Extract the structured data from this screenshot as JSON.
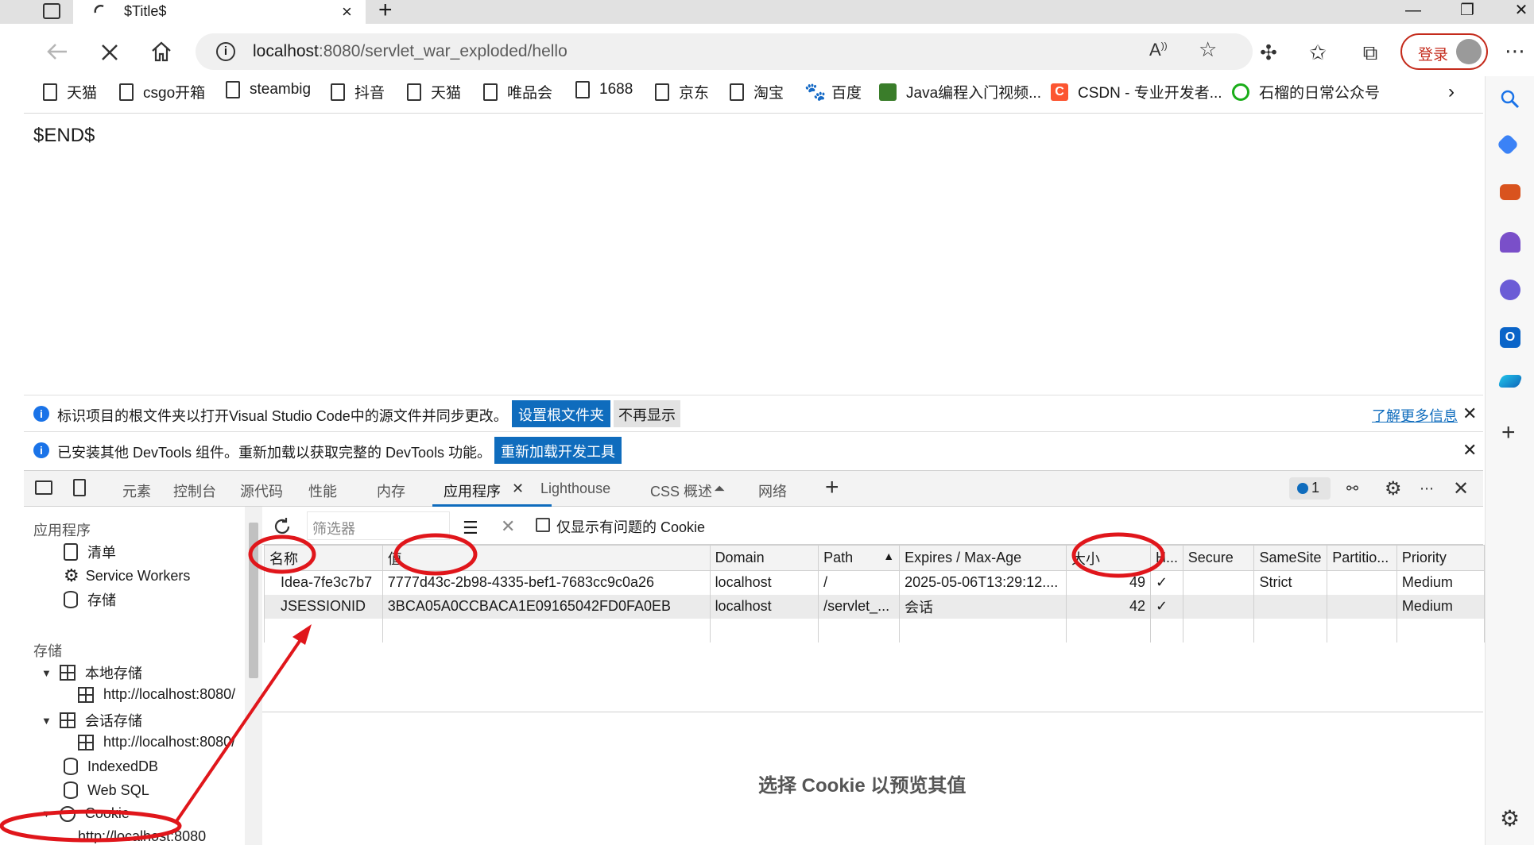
{
  "browser": {
    "tab_title": "$Title$",
    "tab_close": "×",
    "new_tab": "+",
    "window_controls": [
      "—",
      "❐",
      "✕"
    ],
    "url_host": "localhost",
    "url_path": ":8080/servlet_war_exploded/hello",
    "login_label": "登录",
    "menu_icon": "⋯"
  },
  "bookmarks": [
    {
      "label": "天猫",
      "icon": "page-icon"
    },
    {
      "label": "csgo开箱",
      "icon": "page-icon"
    },
    {
      "label": "steambig",
      "icon": "page-icon"
    },
    {
      "label": "抖音",
      "icon": "page-icon"
    },
    {
      "label": "天猫",
      "icon": "page-icon"
    },
    {
      "label": "唯品会",
      "icon": "page-icon"
    },
    {
      "label": "1688",
      "icon": "page-icon"
    },
    {
      "label": "京东",
      "icon": "page-icon"
    },
    {
      "label": "淘宝",
      "icon": "page-icon"
    },
    {
      "label": "百度",
      "icon": "baidu-icon"
    },
    {
      "label": "Java编程入门视频...",
      "icon": "java-video-icon"
    },
    {
      "label": "CSDN - 专业开发者...",
      "icon": "csdn-icon"
    },
    {
      "label": "石榴的日常公众号",
      "icon": "wechat-icon"
    }
  ],
  "page": {
    "body_text": "$END$"
  },
  "infobars": {
    "first_text": "标识项目的根文件夹以打开Visual Studio Code中的源文件并同步更改。",
    "first_primary": "设置根文件夹",
    "first_secondary": "不再显示",
    "first_link": "了解更多信息",
    "second_text": "已安装其他 DevTools 组件。重新加载以获取完整的 DevTools 功能。",
    "second_primary": "重新加载开发工具"
  },
  "devtools": {
    "tabs": [
      "元素",
      "控制台",
      "源代码",
      "性能",
      "内存",
      "应用程序",
      "Lighthouse",
      "CSS 概述",
      "网络"
    ],
    "active_tab": "应用程序",
    "issues_count": "1",
    "left": {
      "section_app": "应用程序",
      "app_items": [
        "清单",
        "Service Workers",
        "存储"
      ],
      "section_storage": "存储",
      "local_storage": "本地存储",
      "local_storage_origin": "http://localhost:8080/",
      "session_storage": "会话存储",
      "session_storage_origin": "http://localhost:8080/",
      "indexeddb": "IndexedDB",
      "websql": "Web SQL",
      "cookie": "Cookie",
      "cookie_origin": "http://localhost:8080"
    },
    "cookies": {
      "filter_placeholder": "筛选器",
      "only_issues_label": "仅显示有问题的 Cookie",
      "columns": [
        "名称",
        "值",
        "Domain",
        "Path",
        "Expires / Max-Age",
        "大小",
        "H...",
        "Secure",
        "SameSite",
        "Partitio...",
        "Priority"
      ],
      "sorted_column": "Path",
      "rows": [
        [
          "Idea-7fe3c7b7",
          "7777d43c-2b98-4335-bef1-7683cc9c0a26",
          "localhost",
          "/",
          "2025-05-06T13:29:12....",
          "49",
          "✓",
          "",
          "Strict",
          "",
          "Medium"
        ],
        [
          "JSESSIONID",
          "3BCA05A0CCBACA1E09165042FD0FA0EB",
          "localhost",
          "/servlet_...",
          "会话",
          "42",
          "✓",
          "",
          "",
          "",
          "Medium"
        ]
      ],
      "selected_row": 1,
      "preview_text": "选择 Cookie 以预览其值"
    }
  },
  "colors": {
    "accent": "#0f6cbd",
    "annotation": "#e0161b"
  }
}
